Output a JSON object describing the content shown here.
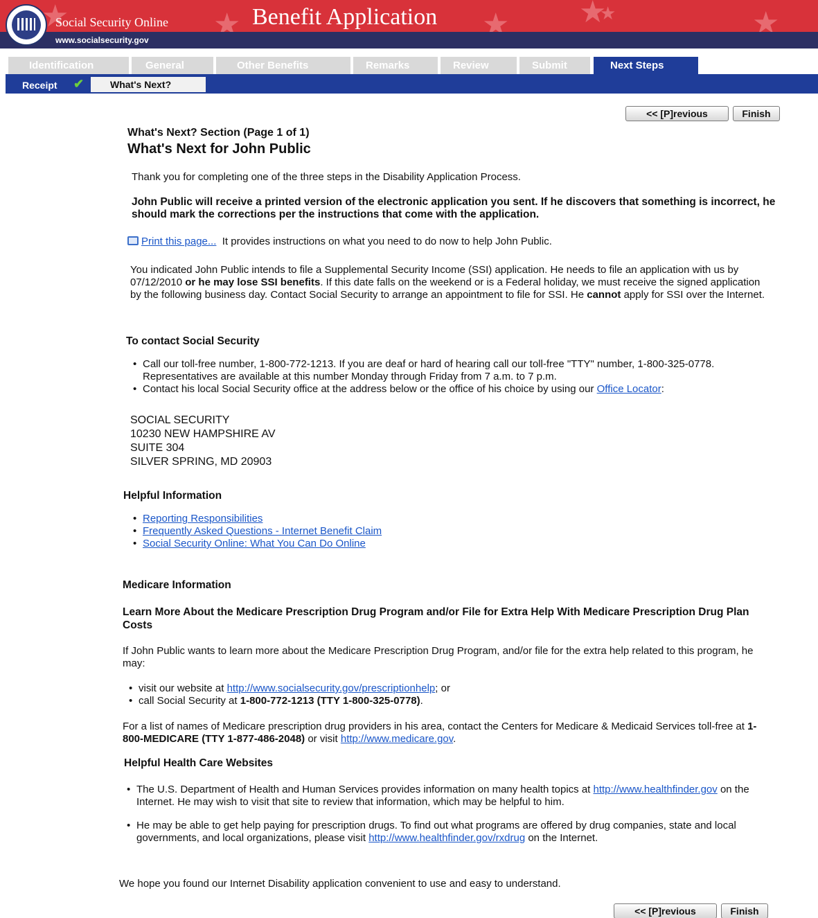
{
  "header": {
    "site_name": "Social Security Online",
    "site_url": "www.socialsecurity.gov",
    "app_title": "Benefit Application",
    "seal_text": "SOCIAL SECURITY ADMINISTRATION",
    "brand_color": "#d8323a",
    "sub_color": "#2c2f63"
  },
  "tabs": [
    {
      "label": "Identification"
    },
    {
      "label": "General"
    },
    {
      "label": "Other Benefits"
    },
    {
      "label": "Remarks"
    },
    {
      "label": "Review"
    },
    {
      "label": "Submit"
    },
    {
      "label": "Next Steps",
      "active": true
    }
  ],
  "subnav": {
    "receipt": "Receipt",
    "whats_next": "What's Next?"
  },
  "buttons": {
    "previous": "<< [P]revious",
    "finish": "Finish"
  },
  "main": {
    "section_title": "What's Next? Section (Page 1 of 1)",
    "page_title": "What's Next for John Public",
    "thanks": "Thank you for completing one of the three steps in the Disability Application Process.",
    "notice": "John Public will receive a printed version of the electronic application you sent. If he discovers that something is incorrect, he should mark the corrections per the instructions that come with the application.",
    "print_link": "Print this page...",
    "print_desc": "It provides instructions on what you need to do now to help John Public.",
    "ssi": {
      "p1": "You indicated John Public intends to file a Supplemental Security Income (SSI) application. He needs to file an application with us by 07/12/2010",
      "p1_bold": "or he may lose SSI benefits",
      "p2": ". If this date falls on the weekend or is a Federal holiday, we must receive the signed application by the following business day. Contact Social Security to arrange an appointment to file for SSI. He",
      "p2_bold": "cannot",
      "p3": "apply for SSI over the Internet."
    },
    "contact": {
      "heading": "To contact Social Security",
      "bullet1": "Call our toll-free number, 1-800-772-1213. If you are deaf or hard of hearing call our toll-free \"TTY\" number, 1-800-325-0778. Representatives are available at this number Monday through Friday from 7 a.m. to 7 p.m.",
      "bullet2_pre": "Contact his local Social Security office at the address below or the office of his choice by using our",
      "bullet2_link": "Office Locator",
      "bullet2_post": ":",
      "address": [
        "SOCIAL SECURITY",
        "10230 NEW HAMPSHIRE AV",
        "SUITE 304",
        "SILVER SPRING, MD 20903"
      ]
    },
    "helpful": {
      "heading": "Helpful Information",
      "links": [
        "Reporting Responsibilities",
        "Frequently Asked Questions - Internet Benefit Claim",
        "Social Security Online: What You Can Do Online"
      ]
    },
    "medicare": {
      "heading": "Medicare Information",
      "subheading": "Learn More About the Medicare Prescription Drug Program and/or File for Extra Help With Medicare Prescription Drug Plan Costs",
      "intro": "If John Public wants to learn more about the Medicare Prescription Drug Program, and/or file for the extra help related to this program, he may:",
      "b1_pre": "visit our website at",
      "b1_link": "http://www.socialsecurity.gov/prescriptionhelp",
      "b1_post": "; or",
      "b2_pre": "call Social Security at",
      "b2_bold": "1-800-772-1213 (TTY 1-800-325-0778)",
      "b2_post": ".",
      "providers_pre": "For a list of names of Medicare prescription drug providers in his area, contact the Centers for Medicare & Medicaid Services toll-free at",
      "providers_bold": "1-800-MEDICARE (TTY 1-877-486-2048)",
      "providers_mid": "or visit",
      "providers_link": "http://www.medicare.gov",
      "providers_post": "."
    },
    "websites": {
      "heading": "Helpful Health Care Websites",
      "b1_pre": "The U.S. Department of Health and Human Services provides information on many health topics at",
      "b1_link": "http://www.healthfinder.gov",
      "b1_post": "on the Internet. He may wish to visit that site to review that information, which may be helpful to him.",
      "b2_pre": "He may be able to get help paying for prescription drugs. To find out what programs are offered by drug companies, state and local governments, and local organizations, please visit",
      "b2_link": "http://www.healthfinder.gov/rxdrug",
      "b2_post": "on the Internet."
    },
    "closing": "We hope you found our Internet Disability application convenient to use and easy to understand."
  }
}
